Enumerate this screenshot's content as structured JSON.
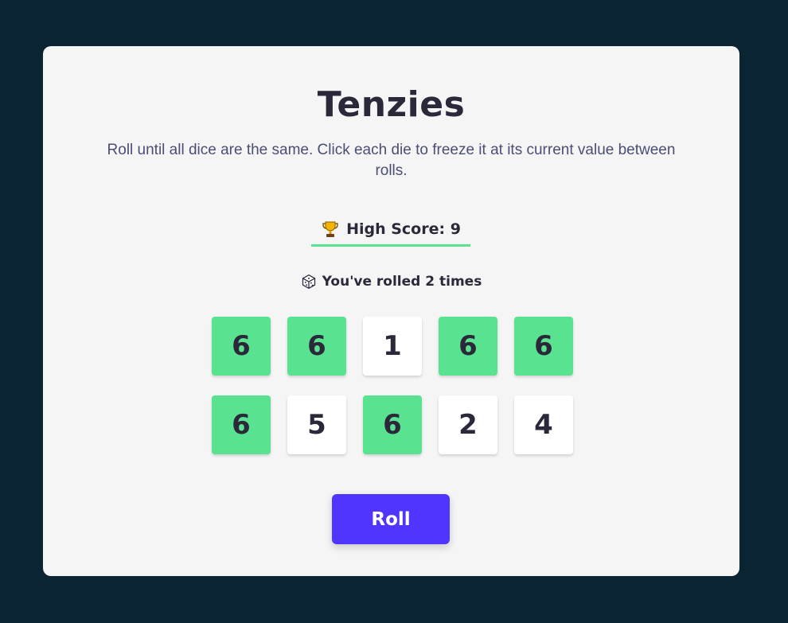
{
  "game": {
    "title": "Tenzies",
    "instructions": "Roll until all dice are the same. Click each die to freeze it at its current value between rolls.",
    "high_score_label": "High Score: 9",
    "high_score_icon": "trophy-icon",
    "roll_count_label": "You've rolled 2 times",
    "roll_count_icon": "dice-icon",
    "roll_button_label": "Roll",
    "colors": {
      "background": "#0b2434",
      "card": "#f5f5f5",
      "held": "#59e391",
      "unheld": "#ffffff",
      "accent": "#5035ff",
      "text": "#2b283a"
    },
    "dice": [
      {
        "value": "6",
        "held": true
      },
      {
        "value": "6",
        "held": true
      },
      {
        "value": "1",
        "held": false
      },
      {
        "value": "6",
        "held": true
      },
      {
        "value": "6",
        "held": true
      },
      {
        "value": "6",
        "held": true
      },
      {
        "value": "5",
        "held": false
      },
      {
        "value": "6",
        "held": true
      },
      {
        "value": "2",
        "held": false
      },
      {
        "value": "4",
        "held": false
      }
    ]
  }
}
